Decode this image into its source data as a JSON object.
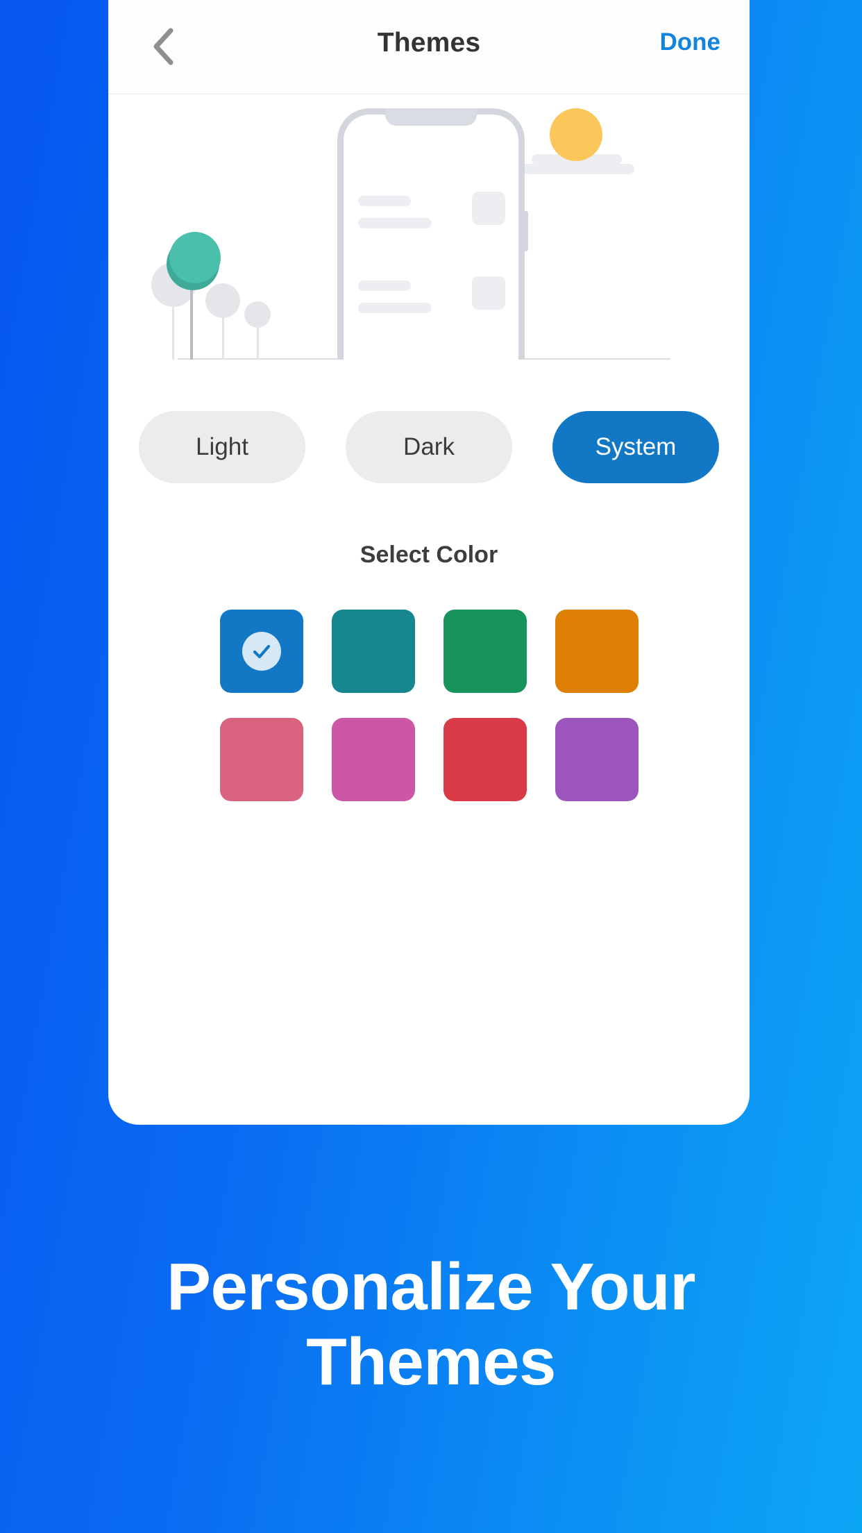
{
  "header": {
    "back_icon": "chevron-left-icon",
    "title": "Themes",
    "done_label": "Done"
  },
  "illustration": {
    "sun_color": "#fbc65a",
    "tree_color": "#45b5a4",
    "phone_frame_color": "#d3d6dc"
  },
  "modes": {
    "options": [
      {
        "label": "Light",
        "selected": false
      },
      {
        "label": "Dark",
        "selected": false
      },
      {
        "label": "System",
        "selected": true
      }
    ],
    "active_color": "#1278c5"
  },
  "color_section": {
    "heading": "Select Color",
    "check_icon": "check-icon",
    "swatches": [
      {
        "name": "blue",
        "hex": "#1278c5",
        "selected": true
      },
      {
        "name": "teal",
        "hex": "#16868f",
        "selected": false
      },
      {
        "name": "green",
        "hex": "#17945b",
        "selected": false
      },
      {
        "name": "orange",
        "hex": "#df8005",
        "selected": false
      },
      {
        "name": "rose",
        "hex": "#d9637f",
        "selected": false
      },
      {
        "name": "magenta",
        "hex": "#cc57a4",
        "selected": false
      },
      {
        "name": "red",
        "hex": "#d93a48",
        "selected": false
      },
      {
        "name": "purple",
        "hex": "#9c55bd",
        "selected": false
      }
    ]
  },
  "caption": {
    "line1": "Personalize Your",
    "line2": "Themes"
  },
  "background": {
    "gradient_from": "#0656f0",
    "gradient_to": "#0ca6f6"
  }
}
